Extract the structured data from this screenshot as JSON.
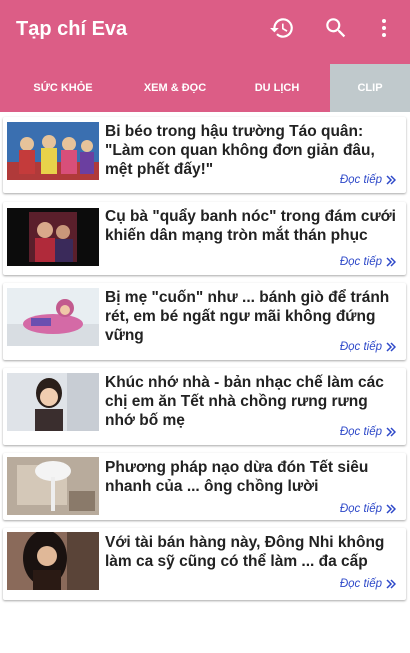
{
  "app": {
    "title": "Tạp chí Eva"
  },
  "toolbar_icons": [
    "history-icon",
    "search-icon",
    "more-vert-icon"
  ],
  "colors": {
    "accent": "#dc5d86",
    "active_tab": "#c0c9cc",
    "link": "#2e49c9"
  },
  "tabs": [
    {
      "label": "SỨC KHỎE",
      "active": false
    },
    {
      "label": "XEM & ĐỌC",
      "active": false
    },
    {
      "label": "DU LỊCH",
      "active": false
    },
    {
      "label": "CLIP",
      "active": true
    }
  ],
  "articles": [
    {
      "title": "Bi béo trong hậu trường Táo quân: \"Làm con quan không đơn giản đâu, mệt phết đấy!\"",
      "more": "Đọc tiếp"
    },
    {
      "title": "Cụ bà \"quẩy banh nóc\" trong đám cưới khiến dân mạng tròn mắt thán phục",
      "more": "Đọc tiếp"
    },
    {
      "title": "Bị mẹ \"cuốn\" như ... bánh giò để tránh rét, em bé ngất ngư mãi không đứng vững",
      "more": "Đọc tiếp"
    },
    {
      "title": "Khúc nhớ nhà - bản nhạc chế làm các chị em ăn Tết nhà chồng rưng rưng nhớ bố mẹ",
      "more": "Đọc tiếp"
    },
    {
      "title": "Phương pháp nạo dừa đón Tết siêu nhanh của ... ông chồng lười",
      "more": "Đọc tiếp"
    },
    {
      "title": "Với tài bán hàng này, Đông Nhi không làm ca sỹ cũng có thể làm ... đa cấp",
      "more": "Đọc tiếp"
    }
  ]
}
